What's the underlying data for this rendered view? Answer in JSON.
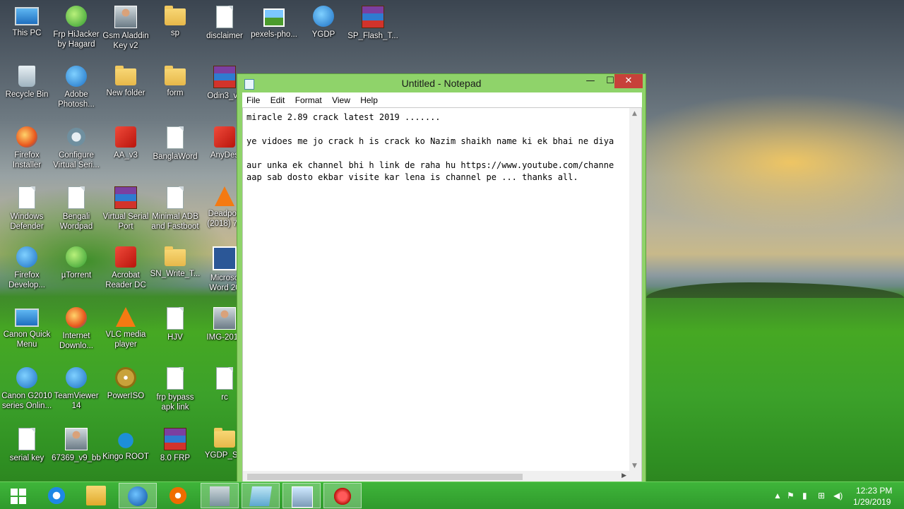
{
  "desktop": {
    "icons": [
      {
        "label": "This PC",
        "icon": "this-pc-icon"
      },
      {
        "label": "Frp HiJacker\nby Hagard",
        "icon": "frp-hijacker-icon"
      },
      {
        "label": "Gsm Aladdin\nKey v2",
        "icon": "gsm-aladdin-icon"
      },
      {
        "label": "sp",
        "icon": "folder-icon"
      },
      {
        "label": "disclaimer",
        "icon": "document-icon"
      },
      {
        "label": "pexels-pho...",
        "icon": "image-icon"
      },
      {
        "label": "YGDP",
        "icon": "ygdp-icon"
      },
      {
        "label": "SP_Flash_T...",
        "icon": "winrar-icon"
      },
      {
        "label": "Recycle Bin",
        "icon": "recycle-bin-icon"
      },
      {
        "label": "Adobe\nPhotosh...",
        "icon": "photoshop-icon"
      },
      {
        "label": "New folder",
        "icon": "folder-icon"
      },
      {
        "label": "form",
        "icon": "folder-icon"
      },
      {
        "label": "Odin3_v3",
        "icon": "winrar-icon"
      },
      {
        "label": "Firefox\nInstaller",
        "icon": "firefox-icon"
      },
      {
        "label": "Configure\nVirtual Seri...",
        "icon": "gear-icon"
      },
      {
        "label": "AA_v3",
        "icon": "aa-icon"
      },
      {
        "label": "BanglaWord",
        "icon": "banglaword-icon"
      },
      {
        "label": "AnyDes",
        "icon": "anydesk-icon"
      },
      {
        "label": "Windows\nDefender",
        "icon": "defender-icon"
      },
      {
        "label": "Bengali\nWordpad",
        "icon": "wordpad-icon"
      },
      {
        "label": "Virtual Serial\nPort",
        "icon": "winrar-icon"
      },
      {
        "label": "Minimal ADB\nand Fastboot",
        "icon": "adb-icon"
      },
      {
        "label": "Deadpoo\n(2018) 72",
        "icon": "vlc-icon"
      },
      {
        "label": "Firefox\nDevelop...",
        "icon": "firefox-developer-icon"
      },
      {
        "label": "µTorrent",
        "icon": "utorrent-icon"
      },
      {
        "label": "Acrobat\nReader DC",
        "icon": "acrobat-icon"
      },
      {
        "label": "SN_Write_T...",
        "icon": "folder-icon"
      },
      {
        "label": "Microso\nWord 20",
        "icon": "word-icon"
      },
      {
        "label": "Canon Quick\nMenu",
        "icon": "canon-icon"
      },
      {
        "label": "Internet\nDownlo...",
        "icon": "idm-icon"
      },
      {
        "label": "VLC media\nplayer",
        "icon": "vlc-icon"
      },
      {
        "label": "HJV",
        "icon": "document-icon"
      },
      {
        "label": "IMG-2018",
        "icon": "image-icon"
      },
      {
        "label": "Canon G2010\nseries Onlin...",
        "icon": "canon-icon"
      },
      {
        "label": "TeamViewer\n14",
        "icon": "teamviewer-icon"
      },
      {
        "label": "PowerISO",
        "icon": "poweriso-icon"
      },
      {
        "label": "frp bypass\napk link",
        "icon": "document-icon"
      },
      {
        "label": "rc",
        "icon": "document-icon"
      },
      {
        "label": "serial key",
        "icon": "document-icon"
      },
      {
        "label": "67369_v9_bb",
        "icon": "person-photo-icon"
      },
      {
        "label": "Kingo ROOT",
        "icon": "kingo-root-icon"
      },
      {
        "label": "8.0 FRP",
        "icon": "winrar-icon"
      },
      {
        "label": "YGDP_Set",
        "icon": "folder-icon"
      }
    ]
  },
  "notepad": {
    "title": "Untitled - Notepad",
    "menu": [
      "File",
      "Edit",
      "Format",
      "View",
      "Help"
    ],
    "content": "miracle 2.89 crack latest 2019 .......\n\nye vidoes me jo crack h is crack ko Nazim shaikh name ki ek bhai ne diya\n\naur unka ek channel bhi h link de raha hu https://www.youtube.com/channe\naap sab dosto ekbar visite kar lena is channel pe ... thanks all.",
    "controls": {
      "minimize": "—",
      "maximize": "☐",
      "close": "✕"
    }
  },
  "taskbar": {
    "apps": [
      "start-icon",
      "internet-explorer-icon",
      "file-explorer-icon",
      "firefox-icon",
      "media-player-icon",
      "virtual-machine-icon",
      "notepad-icon",
      "picture-viewer-icon",
      "miracle-box-icon"
    ],
    "clock": {
      "time": "12:23 PM",
      "date": "1/29/2019"
    }
  },
  "colors": {
    "window_frame": "#8fd36a",
    "taskbar": "#3fb53a",
    "close_button": "#c7413a"
  }
}
